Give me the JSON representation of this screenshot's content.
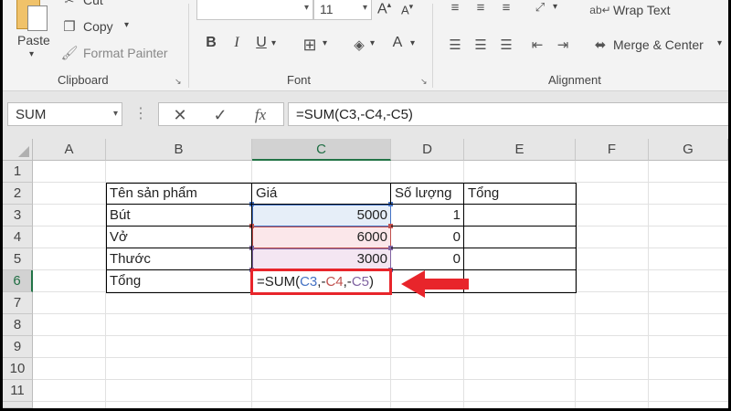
{
  "ribbon": {
    "clipboard": {
      "label": "Clipboard",
      "paste": "Paste",
      "cut": "Cut",
      "copy": "Copy",
      "format_painter": "Format Painter"
    },
    "font": {
      "label": "Font",
      "font_size": "11",
      "bold": "B",
      "italic": "I",
      "underline": "U",
      "font_color": "A"
    },
    "alignment": {
      "label": "Alignment",
      "wrap_text": "Wrap Text",
      "merge_center": "Merge & Center"
    }
  },
  "formula_bar": {
    "name_box": "SUM",
    "cancel_icon": "✕",
    "enter_icon": "✓",
    "fx_label": "fx",
    "formula": "=SUM(C3,-C4,-C5)"
  },
  "grid": {
    "columns": [
      "A",
      "B",
      "C",
      "D",
      "E",
      "F",
      "G"
    ],
    "rows": [
      "1",
      "2",
      "3",
      "4",
      "5",
      "6",
      "7",
      "8",
      "9",
      "10",
      "11"
    ],
    "selected_column": "C",
    "selected_row": "6"
  },
  "table": {
    "headers": [
      "Tên sản phẩm",
      "Giá",
      "Số lượng",
      "Tổng"
    ],
    "rows": [
      {
        "name": "Bút",
        "price": "5000",
        "qty": "1"
      },
      {
        "name": "Vở",
        "price": "6000",
        "qty": "0"
      },
      {
        "name": "Thước",
        "price": "3000",
        "qty": "0"
      }
    ],
    "total_label": "Tổng",
    "active_formula": {
      "prefix": "=SUM(",
      "ref1": "C3",
      "sep1": ",-",
      "ref2": "C4",
      "sep2": ",-",
      "ref3": "C5",
      "suffix": ")"
    }
  },
  "colors": {
    "ref_blue": "#4472c4",
    "ref_red": "#c0504d",
    "ref_purple": "#8064a2",
    "highlight": "#e8252b",
    "excel_green": "#217346"
  },
  "icons": {
    "arrow": "red-arrow-left-icon"
  }
}
